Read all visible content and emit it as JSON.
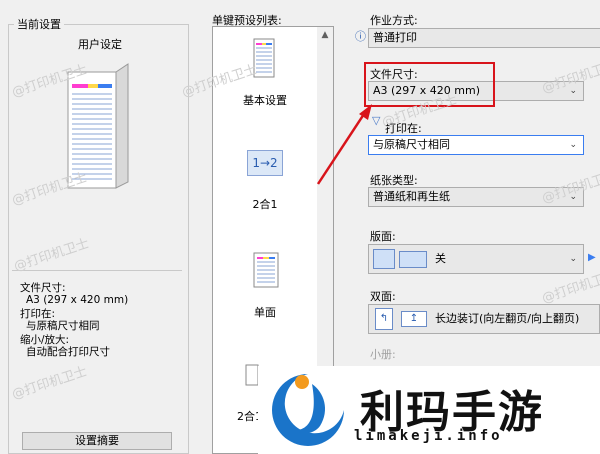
{
  "left_panel": {
    "legend": "当前设置",
    "preview_title": "用户设定",
    "summary": {
      "paper_size_label": "文件尺寸:",
      "paper_size_value": "A3 (297 x 420 mm)",
      "print_on_label": "打印在:",
      "print_on_value": "与原稿尺寸相同",
      "scale_label": "缩小/放大:",
      "scale_value": "自动配合打印尺寸"
    },
    "summary_button": "设置摘要"
  },
  "preset_list": {
    "title": "单键预设列表:",
    "items": [
      {
        "label": "基本设置",
        "icon": "document-icon"
      },
      {
        "label": "2合1",
        "icon": "two-in-one-icon",
        "icon_text": "1→2"
      },
      {
        "label": "单面",
        "icon": "single-side-icon"
      },
      {
        "label": "2合1"
      }
    ]
  },
  "right_panel": {
    "job_type_label": "作业方式:",
    "job_type_value": "普通打印",
    "paper_size_label": "文件尺寸:",
    "paper_size_value": "A3 (297 x 420 mm)",
    "print_on_label": "打印在:",
    "print_on_value": "与原稿尺寸相同",
    "paper_type_label": "纸张类型:",
    "paper_type_value": "普通纸和再生纸",
    "layout_label": "版面:",
    "layout_value": "关",
    "duplex_label": "双面:",
    "duplex_value": "长边装订(向左翻页/向上翻页)",
    "booklet_label": "小册:"
  },
  "watermark": "@打印机卫士",
  "logo": {
    "title": "利玛手游",
    "url": "limakeji.info"
  },
  "colors": {
    "highlight": "#d8141b",
    "logo_blue": "#1a74c9",
    "logo_orange": "#f39a1e"
  }
}
